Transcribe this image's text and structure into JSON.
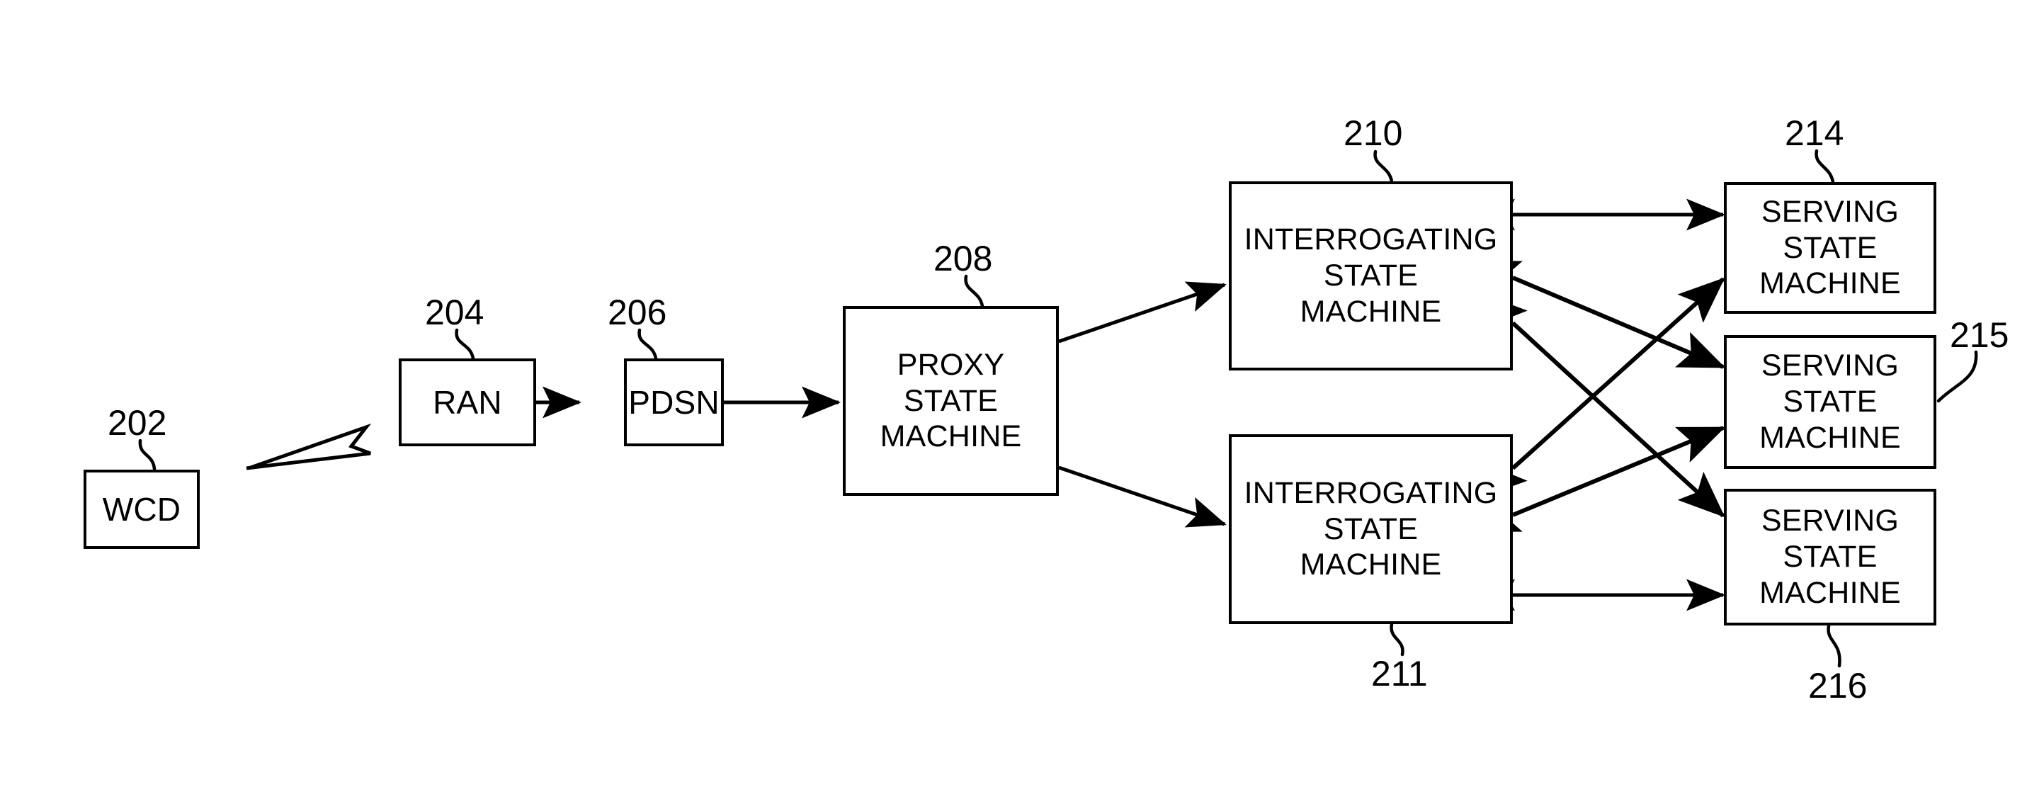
{
  "figure": {
    "type": "patent-block-diagram",
    "background_color": "#ffffff",
    "line_color": "#000000"
  },
  "nodes": [
    {
      "id": "wcd",
      "ref": "202",
      "lines": [
        "WCD"
      ],
      "line1": "WCD"
    },
    {
      "id": "ran",
      "ref": "204",
      "lines": [
        "RAN"
      ],
      "line1": "RAN"
    },
    {
      "id": "pdsn",
      "ref": "206",
      "lines": [
        "PDSN"
      ],
      "line1": "PDSN"
    },
    {
      "id": "proxy_state_machine",
      "ref": "208",
      "lines": [
        "PROXY",
        "STATE",
        "MACHINE"
      ],
      "line1": "PROXY",
      "line2": "STATE",
      "line3": "MACHINE"
    },
    {
      "id": "interrogating_state_machine_top",
      "ref": "210",
      "lines": [
        "INTERROGATING",
        "STATE",
        "MACHINE"
      ],
      "line1": "INTERROGATING",
      "line2": "STATE",
      "line3": "MACHINE"
    },
    {
      "id": "interrogating_state_machine_bottom",
      "ref": "211",
      "lines": [
        "INTERROGATING",
        "STATE",
        "MACHINE"
      ],
      "line1": "INTERROGATING",
      "line2": "STATE",
      "line3": "MACHINE"
    },
    {
      "id": "serving_state_machine_214",
      "ref": "214",
      "lines": [
        "SERVING",
        "STATE",
        "MACHINE"
      ],
      "line1": "SERVING",
      "line2": "STATE",
      "line3": "MACHINE"
    },
    {
      "id": "serving_state_machine_215",
      "ref": "215",
      "lines": [
        "SERVING",
        "STATE",
        "MACHINE"
      ],
      "line1": "SERVING",
      "line2": "STATE",
      "line3": "MACHINE"
    },
    {
      "id": "serving_state_machine_216",
      "ref": "216",
      "lines": [
        "SERVING",
        "STATE",
        "MACHINE"
      ],
      "line1": "SERVING",
      "line2": "STATE",
      "line3": "MACHINE"
    }
  ],
  "reference_numerals": {
    "wcd": "202",
    "ran": "204",
    "pdsn": "206",
    "proxy": "208",
    "interrogating_top": "210",
    "interrogating_bottom": "211",
    "serving_214": "214",
    "serving_215": "215",
    "serving_216": "216"
  },
  "connections": [
    {
      "id": "wcd-to-ran",
      "from": "wcd",
      "to": "ran",
      "style": "wireless-lightning",
      "arrowheads": "none"
    },
    {
      "id": "ran-to-pdsn",
      "from": "ran",
      "to": "pdsn",
      "style": "straight",
      "arrowheads": "end"
    },
    {
      "id": "pdsn-to-proxy",
      "from": "pdsn",
      "to": "proxy_state_machine",
      "style": "straight",
      "arrowheads": "end"
    },
    {
      "id": "proxy-to-ism-top",
      "from": "proxy_state_machine",
      "to": "interrogating_state_machine_top",
      "style": "straight",
      "arrowheads": "end"
    },
    {
      "id": "proxy-to-ism-bottom",
      "from": "proxy_state_machine",
      "to": "interrogating_state_machine_bottom",
      "style": "straight",
      "arrowheads": "end"
    },
    {
      "id": "ism-top-to-ssm-214",
      "from": "interrogating_state_machine_top",
      "to": "serving_state_machine_214",
      "style": "straight",
      "arrowheads": "both"
    },
    {
      "id": "ism-top-to-ssm-215",
      "from": "interrogating_state_machine_top",
      "to": "serving_state_machine_215",
      "style": "straight",
      "arrowheads": "both"
    },
    {
      "id": "ism-top-to-ssm-216",
      "from": "interrogating_state_machine_top",
      "to": "serving_state_machine_216",
      "style": "straight",
      "arrowheads": "both"
    },
    {
      "id": "ism-bottom-to-ssm-214",
      "from": "interrogating_state_machine_bottom",
      "to": "serving_state_machine_214",
      "style": "straight",
      "arrowheads": "both"
    },
    {
      "id": "ism-bottom-to-ssm-215",
      "from": "interrogating_state_machine_bottom",
      "to": "serving_state_machine_215",
      "style": "straight",
      "arrowheads": "both"
    },
    {
      "id": "ism-bottom-to-ssm-216",
      "from": "interrogating_state_machine_bottom",
      "to": "serving_state_machine_216",
      "style": "straight",
      "arrowheads": "both"
    }
  ]
}
